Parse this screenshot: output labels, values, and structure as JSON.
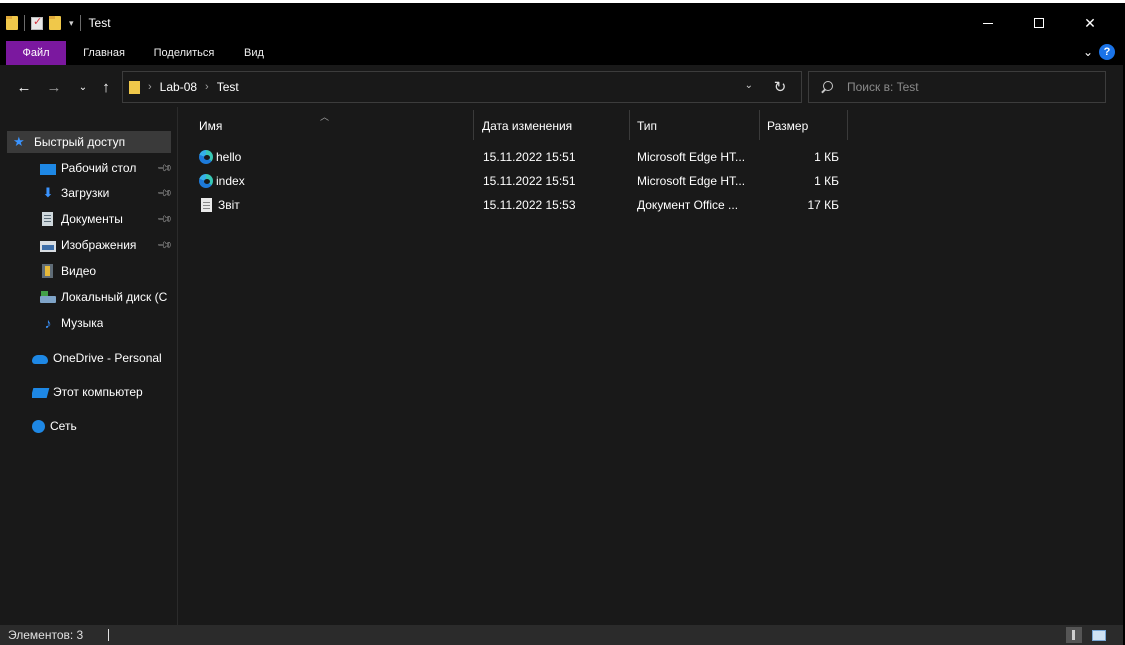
{
  "window": {
    "title": "Test"
  },
  "ribbon": {
    "tabs": [
      {
        "label": "Файл"
      },
      {
        "label": "Главная"
      },
      {
        "label": "Поделиться"
      },
      {
        "label": "Вид"
      }
    ],
    "help_label": "?"
  },
  "nav": {
    "breadcrumbs": [
      "Lab-08",
      "Test"
    ],
    "search_placeholder": "Поиск в: Test"
  },
  "sidebar": {
    "quick_access": "Быстрый доступ",
    "items": [
      {
        "label": "Рабочий стол",
        "icon": "desktop-icon",
        "pinned": true
      },
      {
        "label": "Загрузки",
        "icon": "downloads-icon",
        "pinned": true
      },
      {
        "label": "Документы",
        "icon": "documents-icon",
        "pinned": true
      },
      {
        "label": "Изображения",
        "icon": "pictures-icon",
        "pinned": true
      },
      {
        "label": "Видео",
        "icon": "videos-icon",
        "pinned": false
      },
      {
        "label": "Локальный диск (C",
        "icon": "local-disk-icon",
        "pinned": false
      },
      {
        "label": "Музыка",
        "icon": "music-icon",
        "pinned": false
      }
    ],
    "onedrive": "OneDrive - Personal",
    "this_pc": "Этот компьютер",
    "network": "Сеть"
  },
  "list": {
    "columns": {
      "name": "Имя",
      "date": "Дата изменения",
      "type": "Тип",
      "size": "Размер"
    },
    "rows": [
      {
        "name": "hello",
        "date": "15.11.2022 15:51",
        "type": "Microsoft Edge HT...",
        "size": "1 КБ",
        "icon": "edge-icon"
      },
      {
        "name": "index",
        "date": "15.11.2022 15:51",
        "type": "Microsoft Edge HT...",
        "size": "1 КБ",
        "icon": "edge-icon"
      },
      {
        "name": "Звіт",
        "date": "15.11.2022 15:53",
        "type": "Документ Office ...",
        "size": "17 КБ",
        "icon": "document-icon"
      }
    ]
  },
  "status": {
    "item_count": "Элементов: 3"
  },
  "colors": {
    "accent_file_tab": "#7b189f",
    "background": "#191919",
    "titlebar": "#000000"
  }
}
